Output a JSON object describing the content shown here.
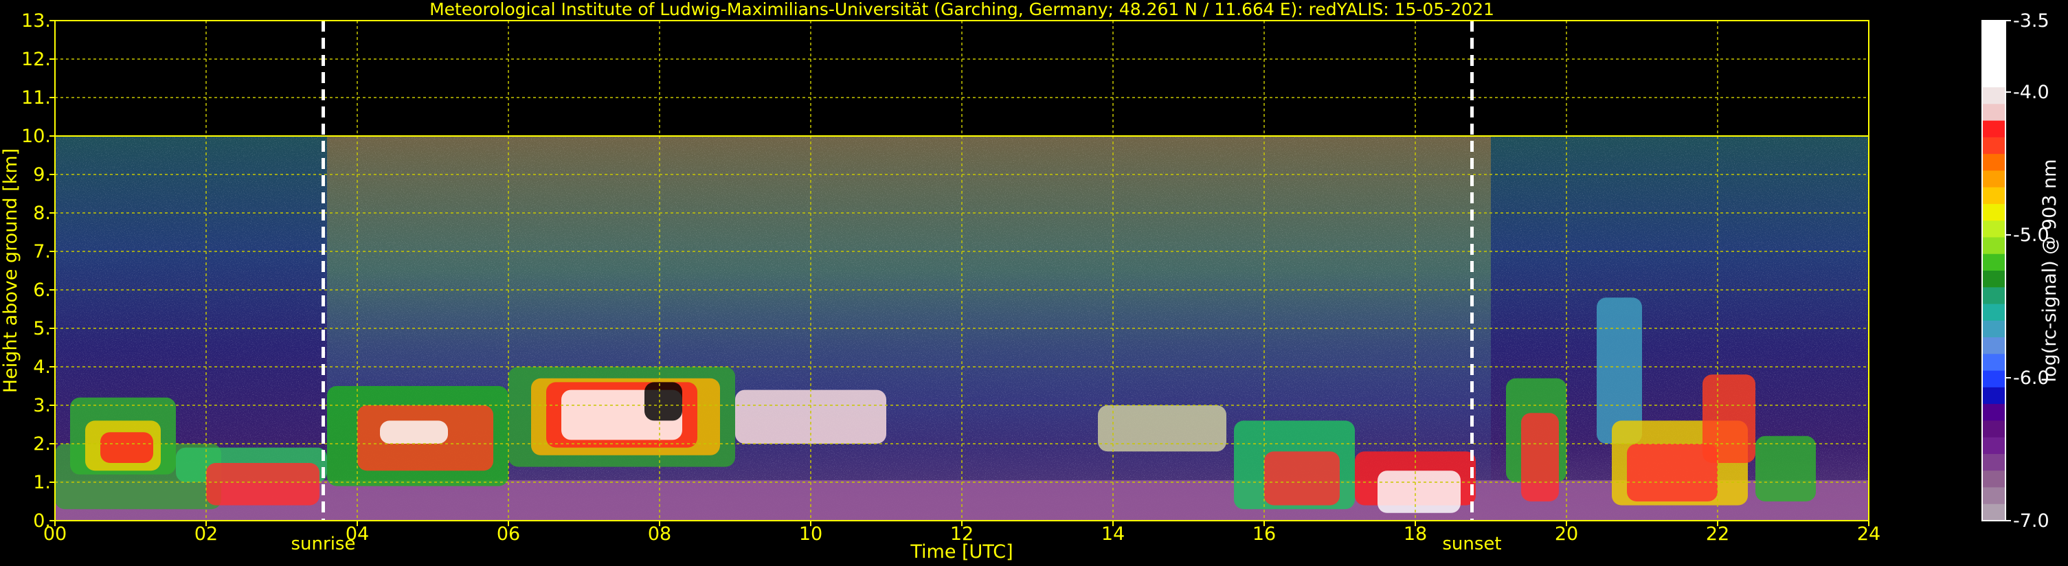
{
  "chart_data": {
    "type": "heatmap",
    "title": "Meteorological Institute of Ludwig-Maximilians-Universität (Garching, Germany; 48.261 N / 11.664 E):    redYALIS: 15-05-2021",
    "xlabel": "Time [UTC]",
    "ylabel": "Height above ground [km]",
    "colorbar_label": "log(rc-signal) @ 903 nm",
    "xlim": [
      0,
      24
    ],
    "ylim": [
      0,
      13
    ],
    "x_ticks": [
      "00",
      "02",
      "04",
      "06",
      "08",
      "10",
      "12",
      "14",
      "16",
      "18",
      "20",
      "22",
      "24"
    ],
    "y_ticks": [
      "0.",
      "1.",
      "2.",
      "3.",
      "4.",
      "5.",
      "6.",
      "7.",
      "8.",
      "9.",
      "10.",
      "11.",
      "12.",
      "13."
    ],
    "colorbar_range": [
      -7.0,
      -3.5
    ],
    "colorbar_ticks": [
      "-3.5",
      "-4.0",
      "-5.0",
      "-6.0",
      "-7.0"
    ],
    "data_top_km": 10,
    "grid": true,
    "markers": [
      {
        "label": "sunrise",
        "x": 3.55
      },
      {
        "label": "sunset",
        "x": 18.75
      }
    ],
    "colors": {
      "axis_text": "#ffff00",
      "grid": "#c8c800",
      "background": "#000000",
      "marker_line": "#ffffff"
    }
  }
}
